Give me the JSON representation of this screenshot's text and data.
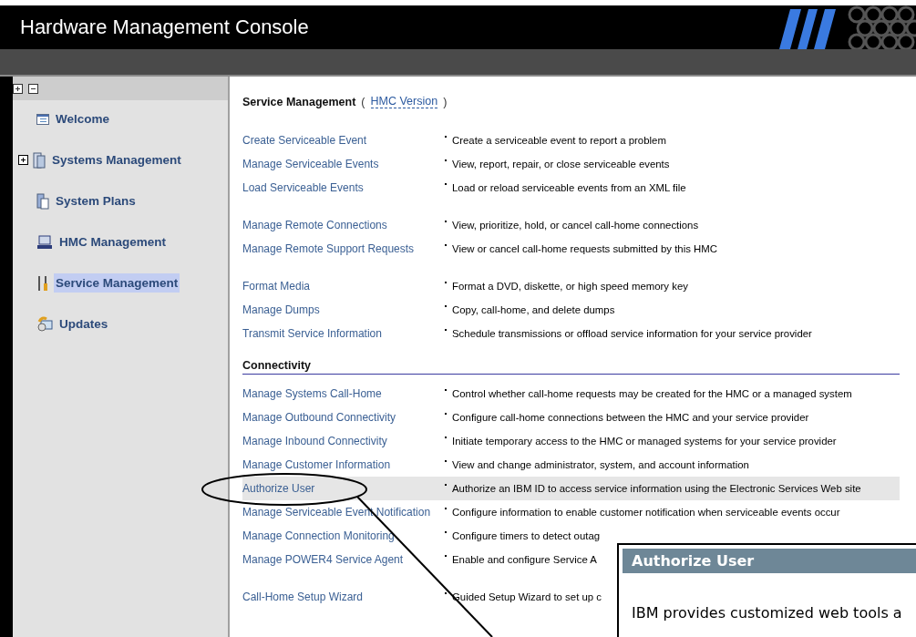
{
  "window": {
    "title": "Hardware Management Console"
  },
  "sidebar": {
    "items": [
      {
        "label": "Welcome",
        "expandable": false,
        "selected": false
      },
      {
        "label": "Systems Management",
        "expandable": true,
        "selected": false
      },
      {
        "label": "System Plans",
        "expandable": false,
        "selected": false
      },
      {
        "label": "HMC Management",
        "expandable": false,
        "selected": false
      },
      {
        "label": "Service Management",
        "expandable": false,
        "selected": true
      },
      {
        "label": "Updates",
        "expandable": false,
        "selected": false
      }
    ]
  },
  "content": {
    "title": "Service Management",
    "open_paren": "(",
    "version_link": "HMC Version",
    "close_paren": ")",
    "sections": [
      {
        "groups": [
          [
            {
              "task": "Create Serviceable Event",
              "description": "Create a serviceable event to report a problem",
              "selected": false
            },
            {
              "task": "Manage Serviceable Events",
              "description": "View, report, repair, or close serviceable events",
              "selected": false
            },
            {
              "task": "Load Serviceable Events",
              "description": "Load or reload serviceable events from an XML file",
              "selected": false
            }
          ],
          [
            {
              "task": "Manage Remote Connections",
              "description": "View, prioritize, hold, or cancel call-home connections",
              "selected": false
            },
            {
              "task": "Manage Remote Support Requests",
              "description": "View or cancel call-home requests submitted by this HMC",
              "selected": false
            }
          ],
          [
            {
              "task": "Format Media",
              "description": "Format a DVD, diskette, or high speed memory key",
              "selected": false
            },
            {
              "task": "Manage Dumps",
              "description": "Copy, call-home, and delete dumps",
              "selected": false
            },
            {
              "task": "Transmit Service Information",
              "description": "Schedule transmissions or offload service information for your service provider",
              "selected": false
            }
          ]
        ]
      },
      {
        "heading": "Connectivity",
        "groups": [
          [
            {
              "task": "Manage Systems Call-Home",
              "description": "Control whether call-home requests may be created for the HMC or a managed system",
              "selected": false
            },
            {
              "task": "Manage Outbound Connectivity",
              "description": "Configure call-home connections between the HMC and your service provider",
              "selected": false
            },
            {
              "task": "Manage Inbound Connectivity",
              "description": "Initiate temporary access to the HMC or managed systems for your service provider",
              "selected": false
            },
            {
              "task": "Manage Customer Information",
              "description": "View and change administrator, system, and account information",
              "selected": false
            },
            {
              "task": "Authorize User",
              "description": "Authorize an IBM ID to access service information using the Electronic Services Web site",
              "selected": true
            },
            {
              "task": "Manage Serviceable Event Notification",
              "description": "Configure information to enable customer notification when serviceable events occur",
              "selected": false
            },
            {
              "task": "Manage Connection Monitoring",
              "description": "Configure timers to detect outag",
              "selected": false
            },
            {
              "task": "Manage POWER4 Service Agent",
              "description": "Enable and configure Service A",
              "selected": false
            }
          ],
          [
            {
              "task": "Call-Home Setup Wizard",
              "description": "Guided Setup Wizard to set up c",
              "selected": false
            }
          ]
        ]
      }
    ]
  },
  "callout": {
    "title": "Authorize User",
    "text": "IBM provides customized web tools a"
  }
}
